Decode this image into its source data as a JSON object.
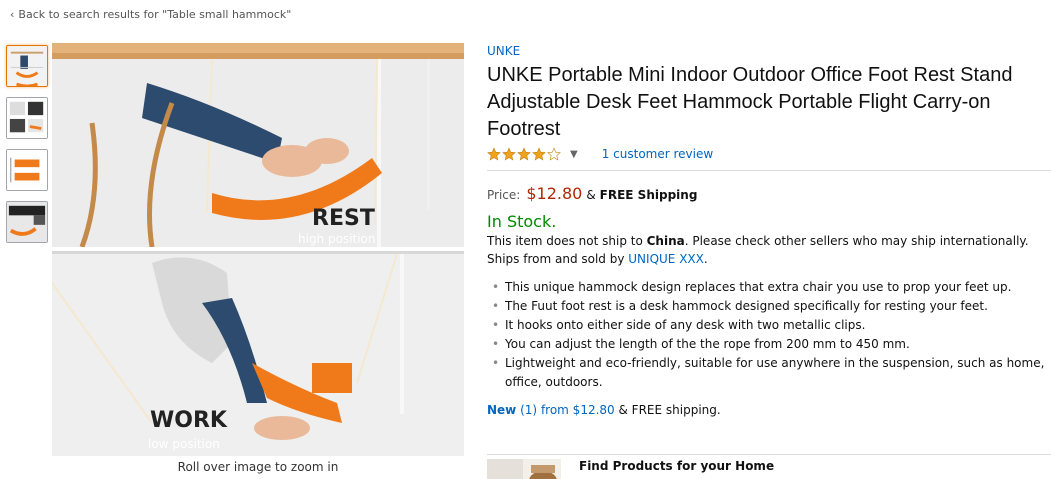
{
  "back_link": "Back to search results for \"Table small hammock\"",
  "thumbnails": [
    "thumb-rest-work",
    "thumb-closeup",
    "thumb-dimensions",
    "thumb-desk"
  ],
  "image": {
    "rest_label": "REST",
    "rest_sub": "high position",
    "work_label": "WORK",
    "work_sub": "low position",
    "zoom_hint": "Roll over image to zoom in"
  },
  "product": {
    "brand": "UNKE",
    "title": "UNKE Portable Mini Indoor Outdoor Office Foot Rest Stand Adjustable Desk Feet Hammock Portable Flight Carry-on Footrest",
    "rating": 4,
    "rating_max": 5,
    "reviews": "1 customer review"
  },
  "price": {
    "label": "Price:",
    "value": "$12.80",
    "amp": "&",
    "shipping": "FREE Shipping"
  },
  "stock": {
    "status": "In Stock.",
    "ship_pre": "This item does not ship to ",
    "ship_country": "China",
    "ship_post": ". Please check other sellers who may ship internationally.",
    "sold_by_pre": "Ships from and sold by ",
    "seller": "UNIQUE XXX",
    "sold_by_post": "."
  },
  "bullets": [
    "This unique hammock design replaces that extra chair you use to prop your feet up.",
    "The Fuut foot rest is a desk hammock designed specifically for resting your feet.",
    "It hooks onto either side of any desk with two metallic clips.",
    "You can adjust the length of the the rope from 200 mm to 450 mm.",
    "Lightweight and eco-friendly, suitable for use anywhere in the suspension, such as home, office, outdoors."
  ],
  "offers": {
    "new_label": "New",
    "count": "(1)",
    "from": "from $12.80",
    "shipping": "& FREE shipping."
  },
  "find": {
    "title": "Find Products for your Home"
  },
  "colors": {
    "link": "#0066c0",
    "price": "#b12704",
    "in_stock": "#008a00",
    "star": "#f0a41d",
    "hammock": "#f07a1a"
  }
}
